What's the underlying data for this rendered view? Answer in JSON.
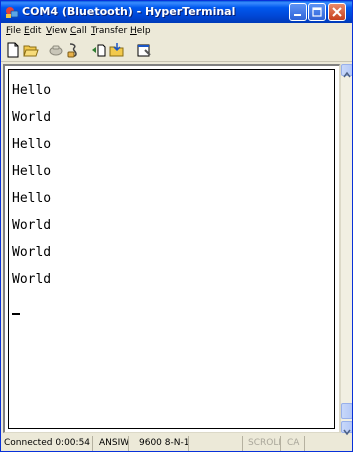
{
  "window": {
    "title": "COM4 (Bluetooth) - HyperTerminal"
  },
  "menu": [
    {
      "label": "File",
      "mnemonic": "F",
      "rest": "ile"
    },
    {
      "label": "Edit",
      "mnemonic": "E",
      "rest": "dit"
    },
    {
      "label": "View",
      "mnemonic": "V",
      "rest": "iew"
    },
    {
      "label": "Call",
      "mnemonic": "C",
      "rest": "all"
    },
    {
      "label": "Transfer",
      "mnemonic": "T",
      "rest": "ransfer"
    },
    {
      "label": "Help",
      "mnemonic": "H",
      "rest": "elp"
    }
  ],
  "toolbar": {
    "icons": [
      "new-icon",
      "open-icon",
      "connect-icon",
      "disconnect-icon",
      "send-icon",
      "receive-icon",
      "properties-icon"
    ]
  },
  "terminal": {
    "lines": [
      "Hello",
      "World",
      "Hello",
      "Hello",
      "Hello",
      "World",
      "World",
      "World"
    ]
  },
  "status": {
    "connected": "Connected 0:00:54",
    "emulation": "ANSIW",
    "port_settings": "9600 8-N-1",
    "scroll": "SCROLL",
    "caps": "CA"
  },
  "colors": {
    "titlebar": "#0058EE",
    "chrome": "#ECE9D8",
    "terminal_bg": "#FFFFFF"
  }
}
